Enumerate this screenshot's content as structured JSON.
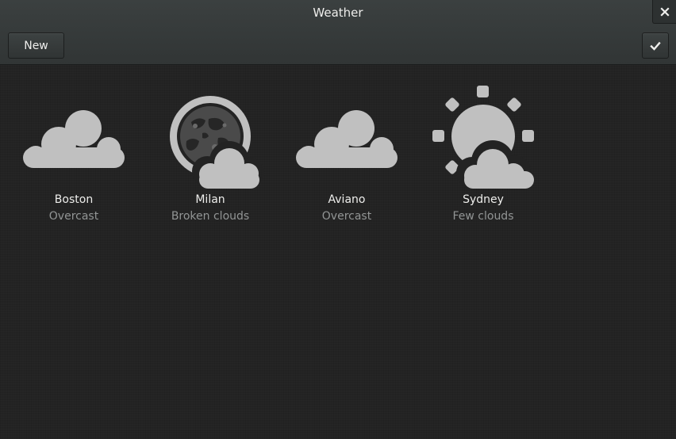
{
  "window": {
    "title": "Weather"
  },
  "headerbar": {
    "new_label": "New",
    "done_icon": "checkmark-icon",
    "close_icon": "close-icon"
  },
  "colors": {
    "icon": "#c0c0c0",
    "background": "#232323",
    "headerbar": "#363b3b",
    "text": "#eeeeec",
    "subtext": "#929595"
  },
  "locations": [
    {
      "city": "Boston",
      "condition": "Overcast",
      "icon": "overcast-cloud-icon"
    },
    {
      "city": "Milan",
      "condition": "Broken clouds",
      "icon": "night-broken-clouds-icon"
    },
    {
      "city": "Aviano",
      "condition": "Overcast",
      "icon": "overcast-cloud-icon"
    },
    {
      "city": "Sydney",
      "condition": "Few clouds",
      "icon": "sun-few-clouds-icon"
    }
  ]
}
